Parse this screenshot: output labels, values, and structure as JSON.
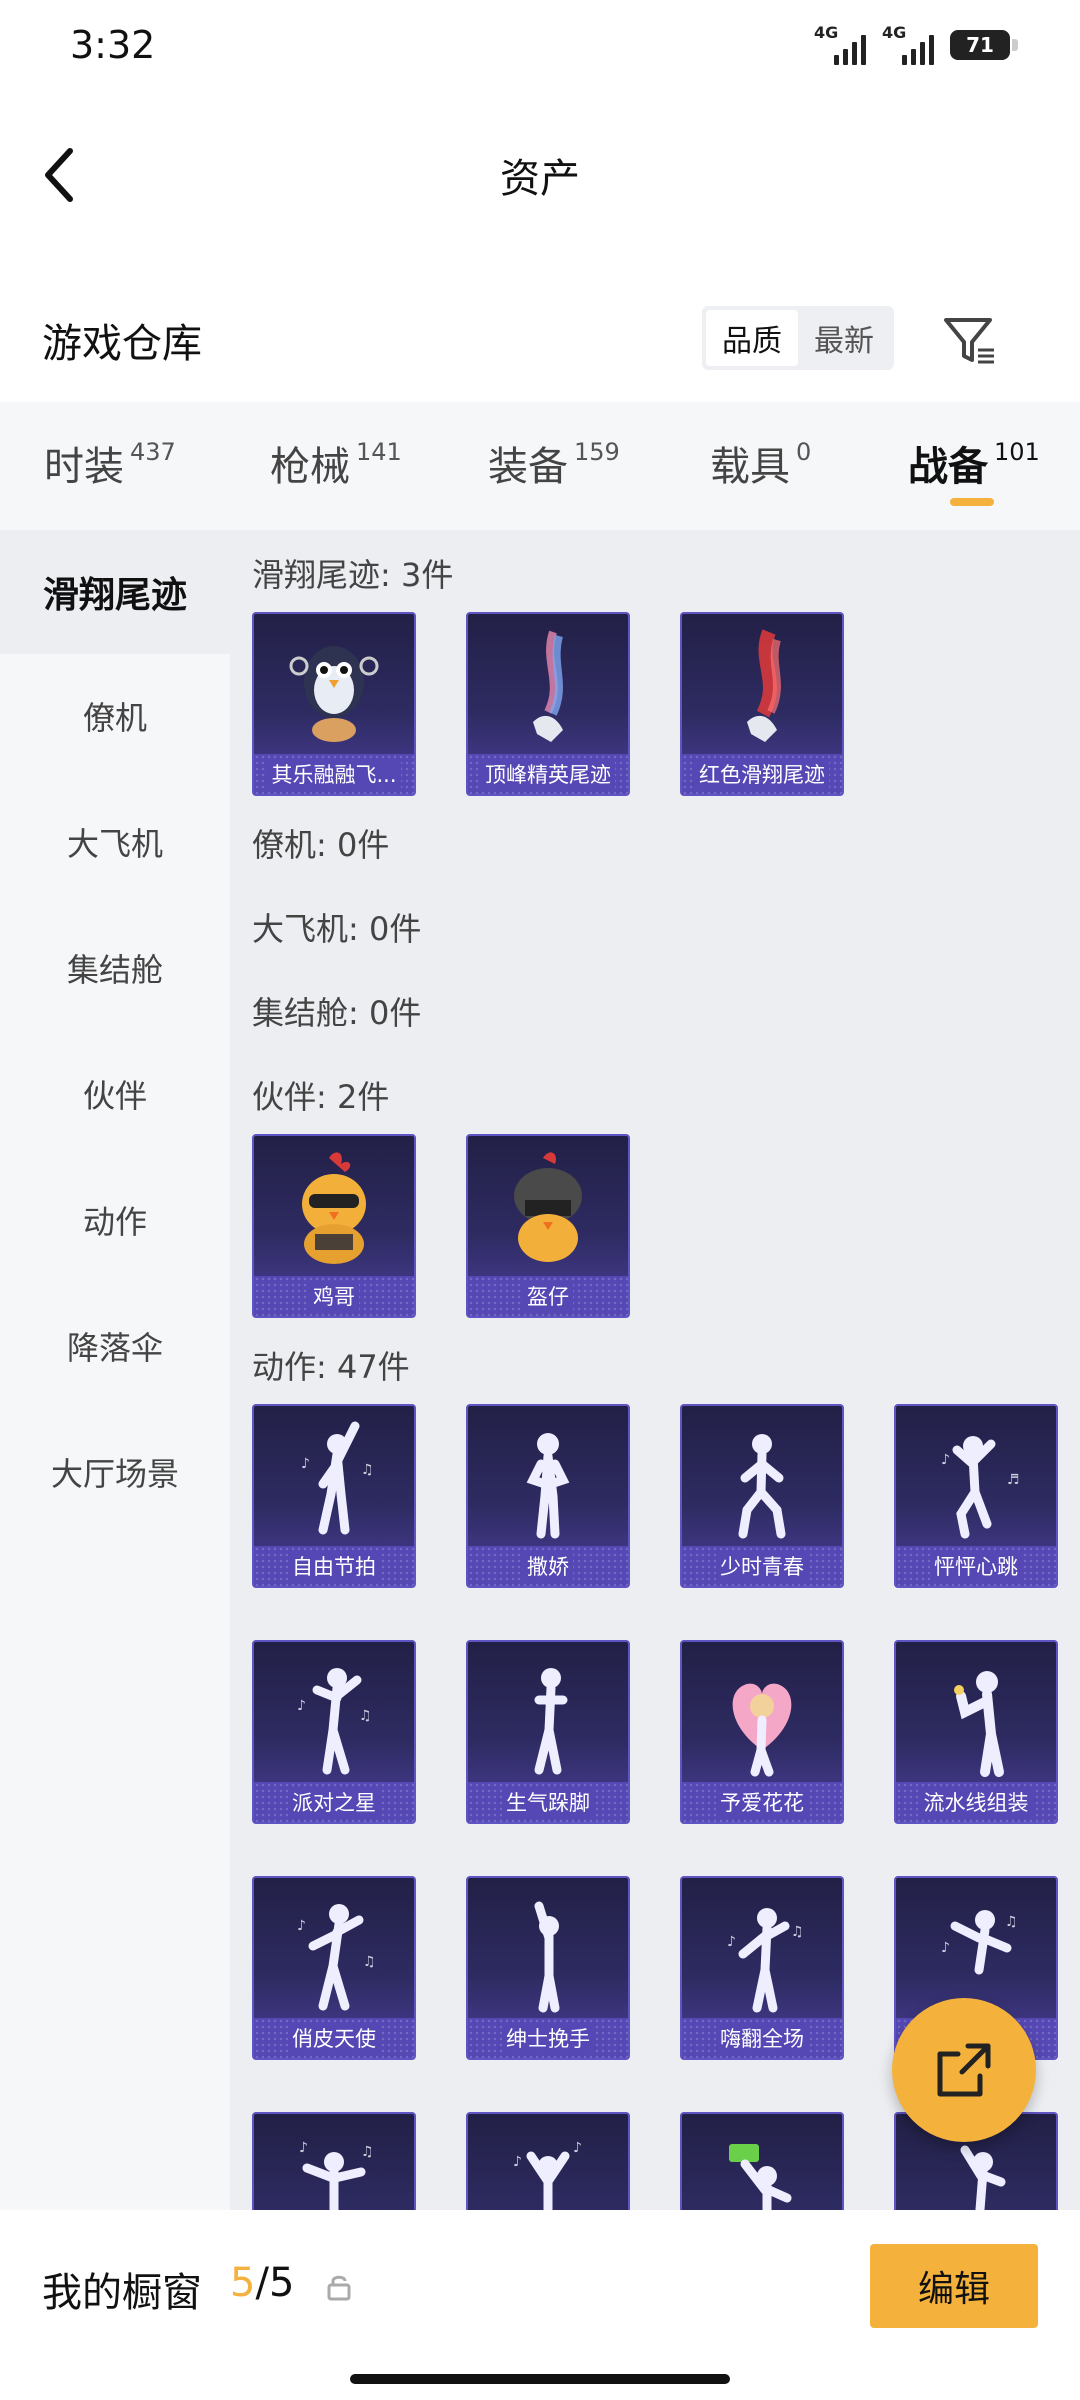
{
  "status": {
    "time": "3:32",
    "network1": "4G",
    "network2": "4G",
    "battery": "71"
  },
  "header": {
    "title": "资产"
  },
  "warehouse": {
    "title": "游戏仓库",
    "sort_options": [
      "品质",
      "最新"
    ]
  },
  "category_tabs": [
    {
      "name": "时装",
      "count": "437"
    },
    {
      "name": "枪械",
      "count": "141"
    },
    {
      "name": "装备",
      "count": "159"
    },
    {
      "name": "载具",
      "count": "0"
    },
    {
      "name": "战备",
      "count": "101"
    }
  ],
  "side_nav": [
    "滑翔尾迹",
    "僚机",
    "大飞机",
    "集结舱",
    "伙伴",
    "动作",
    "降落伞",
    "大厅场景"
  ],
  "sections": {
    "trail": {
      "label": "滑翔尾迹: 3件",
      "items": [
        "其乐融融飞...",
        "顶峰精英尾迹",
        "红色滑翔尾迹"
      ]
    },
    "wingman": {
      "label": "僚机: 0件"
    },
    "plane": {
      "label": "大飞机: 0件"
    },
    "pod": {
      "label": "集结舱: 0件"
    },
    "partner": {
      "label": "伙伴: 2件",
      "items": [
        "鸡哥",
        "盔仔"
      ]
    },
    "emote": {
      "label": "动作: 47件",
      "items": [
        "自由节拍",
        "撒娇",
        "少时青春",
        "怦怦心跳",
        "派对之星",
        "生气跺脚",
        "予爱花花",
        "流水线组装",
        "俏皮天使",
        "绅士挽手",
        "嗨翻全场"
      ]
    }
  },
  "bottom": {
    "label": "我的橱窗",
    "current": "5",
    "slash": "/",
    "max": "5",
    "edit": "编辑"
  },
  "colors": {
    "accent": "#f4b23d",
    "card_caption": "#5548b4"
  }
}
